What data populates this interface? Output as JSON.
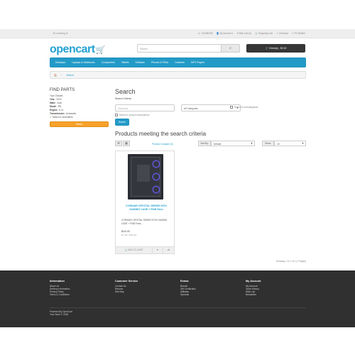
{
  "topbar": {
    "currency": "$ Currency ▾",
    "links": [
      "☏ 123456789",
      "👤 My Account ▾",
      "♥ Wish List (0)",
      "🛒 Shopping Cart",
      "⇪ Checkout",
      "↻ PC Builder"
    ]
  },
  "header": {
    "logo": "opencart",
    "search_placeholder": "Search",
    "cart": "🛒 0 item(s) - $0.00"
  },
  "menu": [
    "Desktops",
    "Laptops & Notebooks",
    "Components",
    "Tablets",
    "Software",
    "Phones & PDAs",
    "Cameras",
    "MP3 Players"
  ],
  "breadcrumb": [
    "🏠",
    "›",
    "Search"
  ],
  "sidebar": {
    "title": "FIND PARTS",
    "subtitle": "Your Chosen:",
    "lines": [
      {
        "k": "Year",
        "v": " : 2016"
      },
      {
        "k": "Make",
        "v": " : Audi"
      },
      {
        "k": "Model",
        "v": " : R8"
      },
      {
        "k": "Engine",
        "v": " : 5.2L"
      },
      {
        "k": "Transmission",
        "v": " : Automatic"
      }
    ],
    "search_in_subfolders": "Search in subfolders",
    "reset": "Reset"
  },
  "main": {
    "title": "Search",
    "criteria_label": "Search Criteria",
    "keyword_value": "Keywords",
    "category": "All Categories",
    "subcategories": "Search in subcategories",
    "product_desc": "Search in product descriptions",
    "search_button": "Search",
    "results_title": "Products meeting the search criteria",
    "product_compare": "Product Compare (0)",
    "sort_label": "Sort By:",
    "sort_value": "Default",
    "show_label": "Show:",
    "show_value": "15",
    "showing": "Showing 1 to 1 of 1 (1 Pages)"
  },
  "product": {
    "title": "CORSAIR CRYSTAL SERIES 570X GAMING CASE + RGB Fans",
    "desc": "CORSAIR CRYSTAL SERIES 570X GAMING CASE + RGB Fans...",
    "price": "$110.00",
    "extax": "Ex Tax: $110.00",
    "add_to_cart": "🛒 ADD TO CART",
    "wish": "♥",
    "compare": "⇄"
  },
  "footer": {
    "columns": [
      {
        "title": "Information",
        "items": [
          "About Us",
          "Delivery Information",
          "Privacy Policy",
          "Terms & Conditions"
        ]
      },
      {
        "title": "Customer Service",
        "items": [
          "Contact Us",
          "Returns",
          "Site Map"
        ]
      },
      {
        "title": "Extras",
        "items": [
          "Brands",
          "Gift Certificates",
          "Affiliates",
          "Specials"
        ]
      },
      {
        "title": "My Account",
        "items": [
          "My Account",
          "Order History",
          "Wish List",
          "Newsletter"
        ]
      }
    ],
    "powered": "Powered By OpenCart",
    "copyright": "Your Store © 2018"
  }
}
